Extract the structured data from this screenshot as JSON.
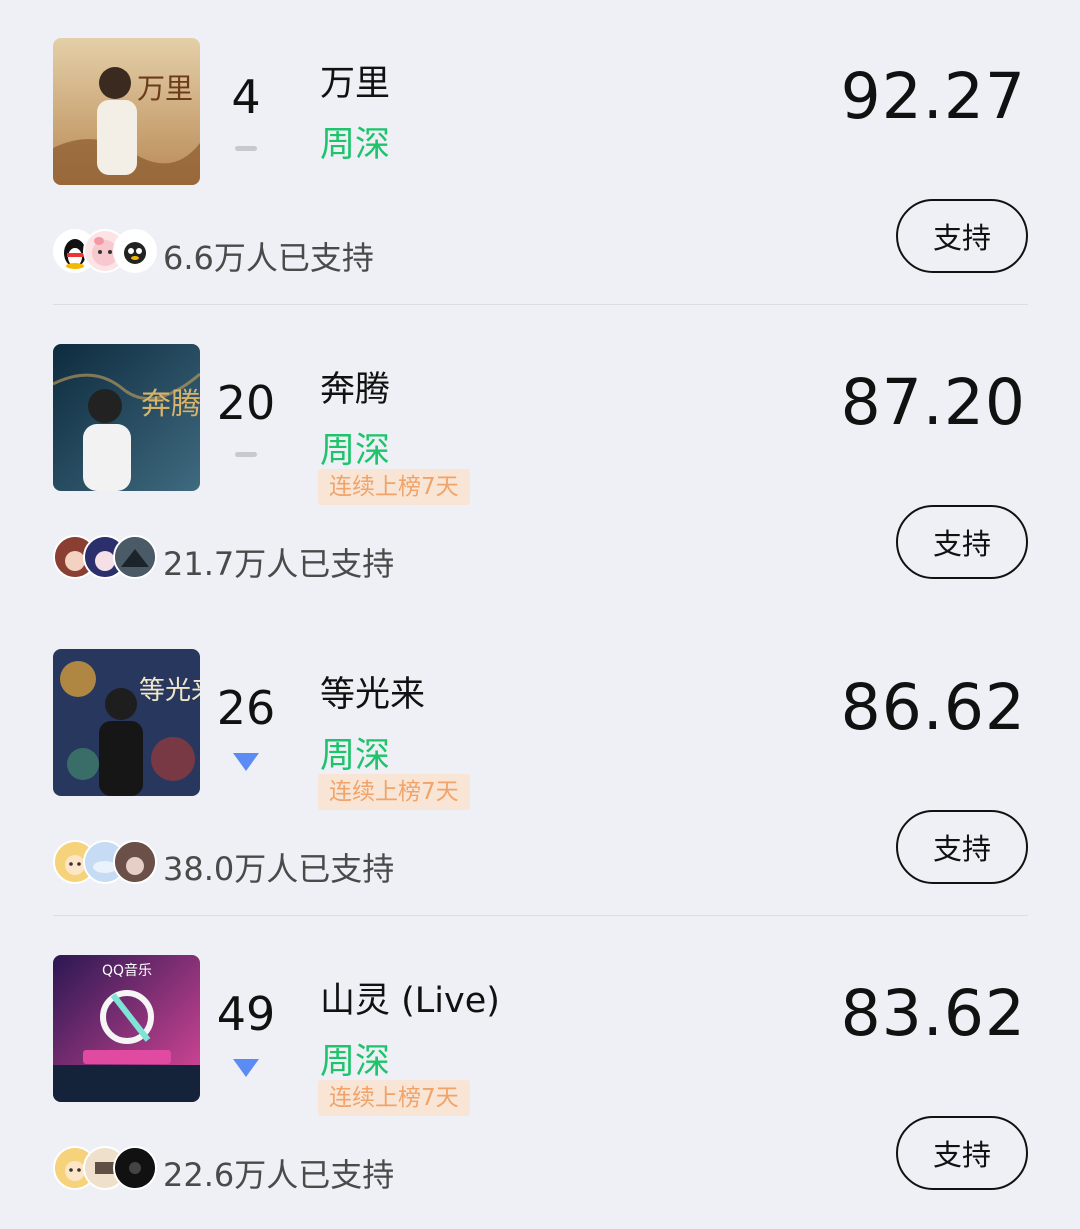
{
  "entries": [
    {
      "rank": "4",
      "trend": "flat",
      "title": "万里",
      "artist": "周深",
      "streak": "",
      "score": "92.27",
      "support_count": "6.6万人已支持",
      "support_label": "支持",
      "cover_text": "万里",
      "cover_colors": [
        "#b98a55",
        "#e4cfa8"
      ],
      "divider": true
    },
    {
      "rank": "20",
      "trend": "flat",
      "title": "奔腾",
      "artist": "周深",
      "streak": "连续上榜7天",
      "score": "87.20",
      "support_count": "21.7万人已支持",
      "support_label": "支持",
      "cover_text": "奔腾",
      "cover_colors": [
        "#0e2b3e",
        "#3f6a80"
      ],
      "divider": false
    },
    {
      "rank": "26",
      "trend": "down",
      "title": "等光来",
      "artist": "周深",
      "streak": "连续上榜7天",
      "score": "86.62",
      "support_count": "38.0万人已支持",
      "support_label": "支持",
      "cover_text": "等光来",
      "cover_colors": [
        "#27375e",
        "#d39a3c"
      ],
      "divider": true
    },
    {
      "rank": "49",
      "trend": "down",
      "title": "山灵 (Live)",
      "artist": "周深",
      "streak": "连续上榜7天",
      "score": "83.62",
      "support_count": "22.6万人已支持",
      "support_label": "支持",
      "cover_text": "QQ音乐",
      "cover_colors": [
        "#2a1852",
        "#e0499a"
      ],
      "divider": false
    }
  ],
  "colors": {
    "artist": "#1ec36b",
    "streak_bg": "#f9e5d5",
    "streak_text": "#f0a46a",
    "trend_down": "#5b8cf5",
    "trend_flat": "#c8c9ce"
  }
}
